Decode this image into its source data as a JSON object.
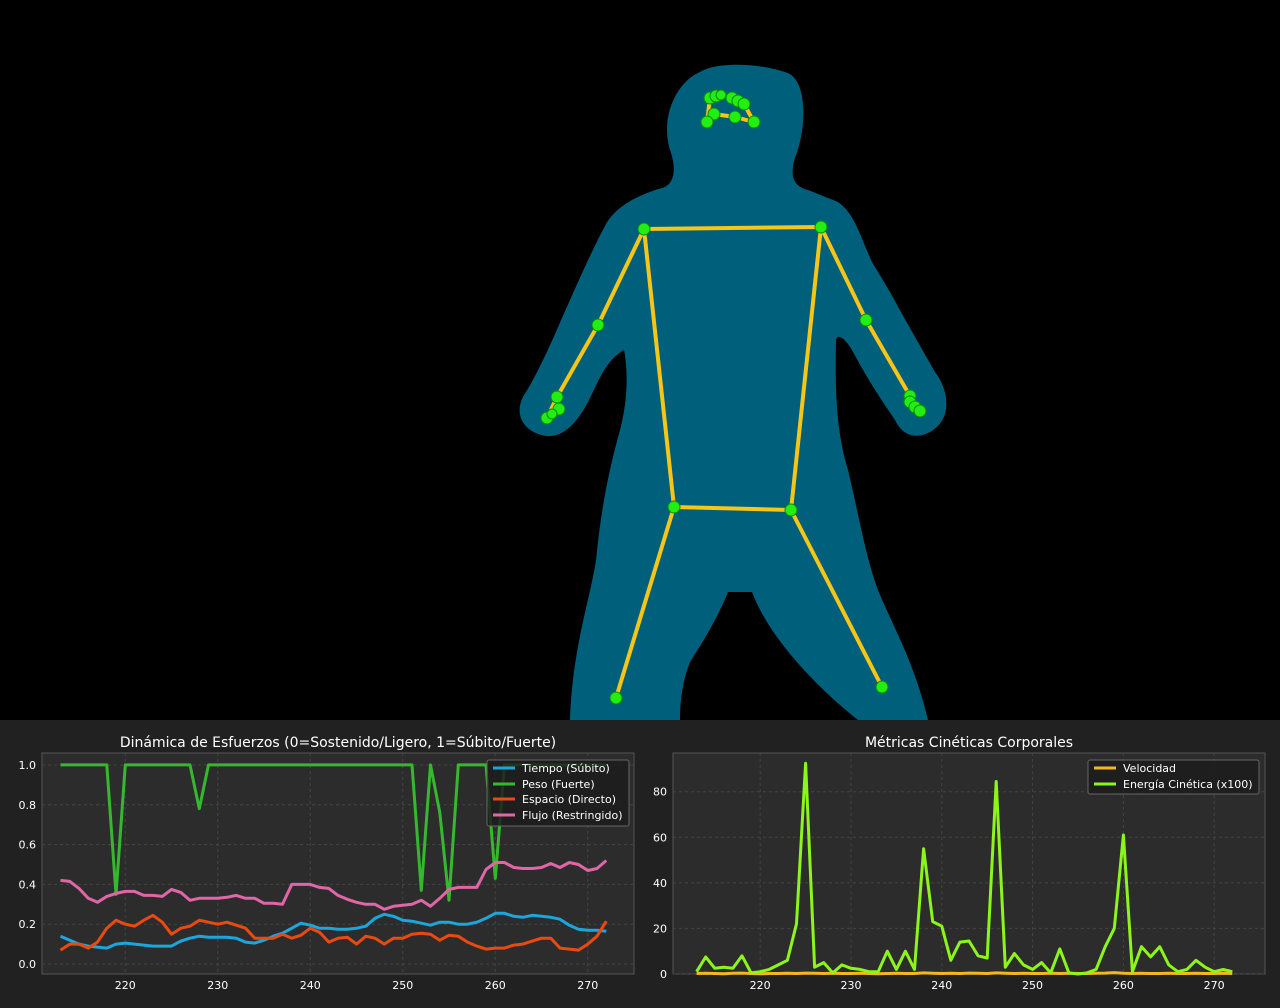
{
  "colors": {
    "silhouette": "#005f7a",
    "bone": "#f5c518",
    "joint": "#22ee11",
    "panel_bg": "#212121",
    "axes_bg": "#2c2c2c",
    "grid": "#444444",
    "text": "#ffffff"
  },
  "chart_data": [
    {
      "type": "line",
      "title": "Dinámica de Esfuerzos (0=Sostenido/Ligero, 1=Súbito/Fuerte)",
      "xlabel": "",
      "ylabel": "",
      "xlim": [
        211,
        275
      ],
      "ylim": [
        -0.05,
        1.06
      ],
      "xticks": [
        220,
        230,
        240,
        250,
        260,
        270
      ],
      "yticks": [
        0.0,
        0.2,
        0.4,
        0.6,
        0.8,
        1.0
      ],
      "ytick_labels": [
        "0.0",
        "0.2",
        "0.4",
        "0.6",
        "0.8",
        "1.0"
      ],
      "grid": true,
      "legend": "top-right",
      "x": [
        213,
        214,
        215,
        216,
        217,
        218,
        219,
        220,
        221,
        222,
        223,
        224,
        225,
        226,
        227,
        228,
        229,
        230,
        231,
        232,
        233,
        234,
        235,
        236,
        237,
        238,
        239,
        240,
        241,
        242,
        243,
        244,
        245,
        246,
        247,
        248,
        249,
        250,
        251,
        252,
        253,
        254,
        255,
        256,
        257,
        258,
        259,
        260,
        261,
        262,
        263,
        264,
        265,
        266,
        267,
        268,
        269,
        270,
        271,
        272
      ],
      "series": [
        {
          "name": "Tiempo (Súbito)",
          "color": "#1ca6dc",
          "values": [
            0.14,
            0.12,
            0.1,
            0.09,
            0.085,
            0.08,
            0.1,
            0.105,
            0.1,
            0.095,
            0.09,
            0.09,
            0.09,
            0.115,
            0.13,
            0.14,
            0.135,
            0.135,
            0.135,
            0.13,
            0.11,
            0.105,
            0.12,
            0.14,
            0.155,
            0.18,
            0.205,
            0.195,
            0.18,
            0.18,
            0.175,
            0.175,
            0.18,
            0.19,
            0.23,
            0.25,
            0.24,
            0.22,
            0.215,
            0.205,
            0.195,
            0.21,
            0.21,
            0.2,
            0.2,
            0.21,
            0.23,
            0.255,
            0.255,
            0.24,
            0.235,
            0.245,
            0.24,
            0.235,
            0.225,
            0.195,
            0.175,
            0.17,
            0.17,
            0.165
          ]
        },
        {
          "name": "Peso (Fuerte)",
          "color": "#36b82e",
          "values": [
            1.0,
            1.0,
            1.0,
            1.0,
            1.0,
            1.0,
            0.35,
            1.0,
            1.0,
            1.0,
            1.0,
            1.0,
            1.0,
            1.0,
            1.0,
            0.78,
            1.0,
            1.0,
            1.0,
            1.0,
            1.0,
            1.0,
            1.0,
            1.0,
            1.0,
            1.0,
            1.0,
            1.0,
            1.0,
            1.0,
            1.0,
            1.0,
            1.0,
            1.0,
            1.0,
            1.0,
            1.0,
            1.0,
            1.0,
            0.37,
            1.0,
            0.76,
            0.32,
            1.0,
            1.0,
            1.0,
            1.0,
            0.43,
            1.0,
            1.0,
            1.0,
            1.0,
            1.0,
            1.0,
            1.0,
            1.0,
            1.0,
            1.0,
            1.0,
            1.0
          ]
        },
        {
          "name": "Espacio (Directo)",
          "color": "#e84a12",
          "values": [
            0.07,
            0.1,
            0.1,
            0.08,
            0.11,
            0.18,
            0.22,
            0.2,
            0.19,
            0.22,
            0.245,
            0.21,
            0.15,
            0.18,
            0.19,
            0.22,
            0.21,
            0.2,
            0.21,
            0.195,
            0.18,
            0.13,
            0.13,
            0.13,
            0.15,
            0.13,
            0.145,
            0.18,
            0.16,
            0.11,
            0.13,
            0.135,
            0.1,
            0.14,
            0.13,
            0.1,
            0.13,
            0.13,
            0.15,
            0.155,
            0.15,
            0.12,
            0.145,
            0.14,
            0.11,
            0.09,
            0.075,
            0.08,
            0.08,
            0.095,
            0.1,
            0.115,
            0.13,
            0.13,
            0.08,
            0.075,
            0.07,
            0.1,
            0.14,
            0.215
          ]
        },
        {
          "name": "Flujo (Restringido)",
          "color": "#e066a8",
          "values": [
            0.42,
            0.415,
            0.38,
            0.33,
            0.31,
            0.34,
            0.355,
            0.365,
            0.365,
            0.345,
            0.345,
            0.34,
            0.375,
            0.36,
            0.32,
            0.33,
            0.33,
            0.33,
            0.335,
            0.345,
            0.33,
            0.33,
            0.305,
            0.305,
            0.3,
            0.4,
            0.4,
            0.4,
            0.385,
            0.38,
            0.345,
            0.325,
            0.31,
            0.3,
            0.3,
            0.275,
            0.29,
            0.295,
            0.3,
            0.32,
            0.29,
            0.33,
            0.375,
            0.385,
            0.385,
            0.385,
            0.475,
            0.51,
            0.51,
            0.485,
            0.48,
            0.48,
            0.485,
            0.505,
            0.485,
            0.51,
            0.5,
            0.47,
            0.48,
            0.52
          ]
        }
      ]
    },
    {
      "type": "line",
      "title": "Métricas Cinéticas Corporales",
      "xlabel": "",
      "ylabel": "",
      "xlim": [
        210.4,
        275.6
      ],
      "ylim": [
        0,
        97
      ],
      "xticks": [
        220,
        230,
        240,
        250,
        260,
        270
      ],
      "yticks": [
        0,
        20,
        40,
        60,
        80
      ],
      "ytick_labels": [
        "0",
        "20",
        "40",
        "60",
        "80"
      ],
      "grid": true,
      "legend": "top-right",
      "x": [
        213,
        214,
        215,
        216,
        217,
        218,
        219,
        220,
        221,
        222,
        223,
        224,
        225,
        226,
        227,
        228,
        229,
        230,
        231,
        232,
        233,
        234,
        235,
        236,
        237,
        238,
        239,
        240,
        241,
        242,
        243,
        244,
        245,
        246,
        247,
        248,
        249,
        250,
        251,
        252,
        253,
        254,
        255,
        256,
        257,
        258,
        259,
        260,
        261,
        262,
        263,
        264,
        265,
        266,
        267,
        268,
        269,
        270,
        271,
        272
      ],
      "series": [
        {
          "name": "Velocidad",
          "color": "#f2b81e",
          "values": [
            0.2,
            0.3,
            0.2,
            0.1,
            0.3,
            0.4,
            0.2,
            0.1,
            0.2,
            0.2,
            0.3,
            0.2,
            0.4,
            0.3,
            0.2,
            0.3,
            0.2,
            0.2,
            0.3,
            0.2,
            0.1,
            0.2,
            0.3,
            0.2,
            0.2,
            0.5,
            0.3,
            0.2,
            0.3,
            0.2,
            0.4,
            0.3,
            0.2,
            0.5,
            0.3,
            0.2,
            0.3,
            0.2,
            0.2,
            0.3,
            0.2,
            0.3,
            0.2,
            0.2,
            0.3,
            0.4,
            0.6,
            0.3,
            0.2,
            0.3,
            0.2,
            0.2,
            0.3,
            0.2,
            0.2,
            0.3,
            0.2,
            0.2,
            0.3,
            0.2
          ]
        },
        {
          "name": "Energía Cinética (x100)",
          "color": "#8cf51a",
          "values": [
            1,
            7.5,
            2.5,
            3,
            2.5,
            8,
            0.5,
            1,
            2,
            4,
            6,
            22,
            92.5,
            3,
            5,
            0.5,
            4,
            2.5,
            2,
            1,
            1,
            10,
            2,
            10,
            2,
            55,
            23,
            21,
            6,
            14,
            14.5,
            8,
            7,
            84.5,
            3,
            9,
            4,
            2,
            5,
            0.5,
            11,
            0.5,
            0,
            0.5,
            2,
            12,
            20,
            61,
            1,
            12,
            7.5,
            12,
            4,
            1,
            2,
            6,
            3,
            1,
            2,
            1
          ]
        }
      ]
    }
  ]
}
